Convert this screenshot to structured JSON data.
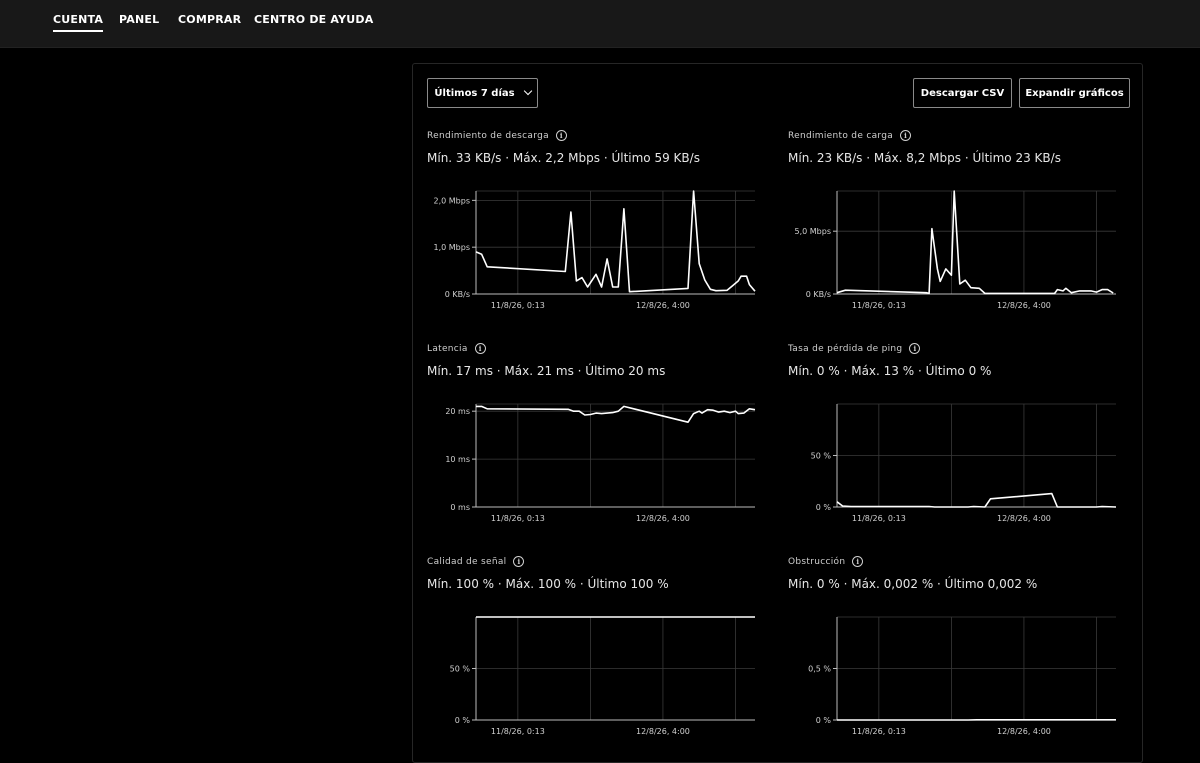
{
  "nav": {
    "items": [
      {
        "label": "CUENTA",
        "active": true
      },
      {
        "label": "PANEL",
        "active": false
      },
      {
        "label": "COMPRAR",
        "active": false
      },
      {
        "label": "CENTRO DE AYUDA",
        "active": false
      }
    ]
  },
  "toolbar": {
    "range_label": "Últimos 7 días",
    "download_label": "Descargar CSV",
    "expand_label": "Expandir gráficos"
  },
  "colors": {
    "line": "#ffffff",
    "grid": "#3a3a3a",
    "axis": "#bdbdbd"
  },
  "chart_data": [
    {
      "type": "line",
      "title": "Rendimiento de descarga",
      "stats": "Mín. 33 KB/s · Máx. 2,2 Mbps · Último 59 KB/s",
      "ylim": [
        0,
        2.2
      ],
      "yticks": [
        {
          "v": 0,
          "label": "0 KB/s"
        },
        {
          "v": 1.0,
          "label": "1,0 Mbps"
        },
        {
          "v": 2.0,
          "label": "2,0 Mbps"
        }
      ],
      "xticks": [
        {
          "t": 0.15,
          "label": "11/8/26, 0:13"
        },
        {
          "t": 0.67,
          "label": "12/8/26, 4:00"
        }
      ],
      "grid_x": [
        0.15,
        0.41,
        0.67,
        0.93
      ],
      "points": [
        [
          0,
          0.9
        ],
        [
          0.02,
          0.85
        ],
        [
          0.04,
          0.58
        ],
        [
          0.32,
          0.48
        ],
        [
          0.34,
          1.75
        ],
        [
          0.36,
          0.28
        ],
        [
          0.38,
          0.35
        ],
        [
          0.4,
          0.15
        ],
        [
          0.43,
          0.42
        ],
        [
          0.45,
          0.15
        ],
        [
          0.47,
          0.75
        ],
        [
          0.49,
          0.15
        ],
        [
          0.51,
          0.15
        ],
        [
          0.53,
          1.82
        ],
        [
          0.55,
          0.05
        ],
        [
          0.76,
          0.12
        ],
        [
          0.78,
          2.2
        ],
        [
          0.8,
          0.65
        ],
        [
          0.82,
          0.3
        ],
        [
          0.84,
          0.1
        ],
        [
          0.86,
          0.07
        ],
        [
          0.9,
          0.08
        ],
        [
          0.92,
          0.18
        ],
        [
          0.94,
          0.28
        ],
        [
          0.95,
          0.38
        ],
        [
          0.97,
          0.38
        ],
        [
          0.98,
          0.2
        ],
        [
          1.0,
          0.06
        ]
      ]
    },
    {
      "type": "line",
      "title": "Rendimiento de carga",
      "stats": "Mín. 23 KB/s · Máx. 8,2 Mbps · Último 23 KB/s",
      "ylim": [
        0,
        8.2
      ],
      "yticks": [
        {
          "v": 0,
          "label": "0 KB/s"
        },
        {
          "v": 5.0,
          "label": "5,0 Mbps"
        }
      ],
      "xticks": [
        {
          "t": 0.15,
          "label": "11/8/26, 0:13"
        },
        {
          "t": 0.67,
          "label": "12/8/26, 4:00"
        }
      ],
      "grid_x": [
        0.15,
        0.41,
        0.67,
        0.93
      ],
      "points": [
        [
          0,
          0.1
        ],
        [
          0.03,
          0.3
        ],
        [
          0.32,
          0.1
        ],
        [
          0.33,
          0.05
        ],
        [
          0.34,
          5.2
        ],
        [
          0.36,
          2.0
        ],
        [
          0.37,
          1.0
        ],
        [
          0.39,
          2.0
        ],
        [
          0.41,
          1.5
        ],
        [
          0.42,
          8.2
        ],
        [
          0.44,
          0.8
        ],
        [
          0.46,
          1.1
        ],
        [
          0.48,
          0.5
        ],
        [
          0.51,
          0.45
        ],
        [
          0.53,
          0.05
        ],
        [
          0.78,
          0.05
        ],
        [
          0.79,
          0.35
        ],
        [
          0.81,
          0.25
        ],
        [
          0.82,
          0.45
        ],
        [
          0.84,
          0.1
        ],
        [
          0.87,
          0.25
        ],
        [
          0.91,
          0.25
        ],
        [
          0.93,
          0.15
        ],
        [
          0.95,
          0.35
        ],
        [
          0.97,
          0.35
        ],
        [
          0.99,
          0.08
        ]
      ]
    },
    {
      "type": "line",
      "title": "Latencia",
      "stats": "Mín. 17 ms · Máx. 21 ms · Último 20 ms",
      "ylim": [
        0,
        21.5
      ],
      "yticks": [
        {
          "v": 0,
          "label": "0 ms"
        },
        {
          "v": 10,
          "label": "10 ms"
        },
        {
          "v": 20,
          "label": "20 ms"
        }
      ],
      "xticks": [
        {
          "t": 0.15,
          "label": "11/8/26, 0:13"
        },
        {
          "t": 0.67,
          "label": "12/8/26, 4:00"
        }
      ],
      "grid_x": [
        0.15,
        0.41,
        0.67,
        0.93
      ],
      "points": [
        [
          0,
          21
        ],
        [
          0.02,
          21
        ],
        [
          0.04,
          20.5
        ],
        [
          0.33,
          20.4
        ],
        [
          0.35,
          20.0
        ],
        [
          0.37,
          20.0
        ],
        [
          0.39,
          19.2
        ],
        [
          0.41,
          19.3
        ],
        [
          0.43,
          19.6
        ],
        [
          0.45,
          19.5
        ],
        [
          0.47,
          19.6
        ],
        [
          0.49,
          19.7
        ],
        [
          0.51,
          20.0
        ],
        [
          0.53,
          21.0
        ],
        [
          0.76,
          17.7
        ],
        [
          0.78,
          19.5
        ],
        [
          0.8,
          20.0
        ],
        [
          0.81,
          19.6
        ],
        [
          0.83,
          20.3
        ],
        [
          0.85,
          20.2
        ],
        [
          0.87,
          19.8
        ],
        [
          0.89,
          20.0
        ],
        [
          0.91,
          19.7
        ],
        [
          0.93,
          20.0
        ],
        [
          0.94,
          19.5
        ],
        [
          0.96,
          19.6
        ],
        [
          0.98,
          20.5
        ],
        [
          1.0,
          20.3
        ]
      ]
    },
    {
      "type": "line",
      "title": "Tasa de pérdida de ping",
      "stats": "Mín. 0 % · Máx. 13 % · Último 0 %",
      "ylim": [
        0,
        100
      ],
      "yticks": [
        {
          "v": 0,
          "label": "0 %"
        },
        {
          "v": 50,
          "label": "50 %"
        }
      ],
      "xticks": [
        {
          "t": 0.15,
          "label": "11/8/26, 0:13"
        },
        {
          "t": 0.67,
          "label": "12/8/26, 4:00"
        }
      ],
      "grid_x": [
        0.15,
        0.41,
        0.67,
        0.93
      ],
      "points": [
        [
          0,
          5
        ],
        [
          0.02,
          1
        ],
        [
          0.05,
          0.5
        ],
        [
          0.33,
          0.5
        ],
        [
          0.35,
          0
        ],
        [
          0.47,
          0
        ],
        [
          0.49,
          0.5
        ],
        [
          0.53,
          0
        ],
        [
          0.55,
          8
        ],
        [
          0.77,
          13
        ],
        [
          0.79,
          0
        ],
        [
          0.93,
          0
        ],
        [
          0.95,
          0.5
        ],
        [
          1.0,
          0
        ]
      ]
    },
    {
      "type": "line",
      "title": "Calidad de señal",
      "stats": "Mín. 100 % · Máx. 100 % · Último 100 %",
      "ylim": [
        0,
        100
      ],
      "yticks": [
        {
          "v": 0,
          "label": "0 %"
        },
        {
          "v": 50,
          "label": "50 %"
        }
      ],
      "xticks": [
        {
          "t": 0.15,
          "label": "11/8/26, 0:13"
        },
        {
          "t": 0.67,
          "label": "12/8/26, 4:00"
        }
      ],
      "grid_x": [
        0.15,
        0.41,
        0.67,
        0.93
      ],
      "points": [
        [
          0,
          100
        ],
        [
          0.5,
          100
        ],
        [
          1.0,
          100
        ]
      ]
    },
    {
      "type": "line",
      "title": "Obstrucción",
      "stats": "Mín. 0 % · Máx. 0,002 % · Último 0,002 %",
      "ylim": [
        0,
        1.0
      ],
      "yticks": [
        {
          "v": 0,
          "label": "0 %"
        },
        {
          "v": 0.5,
          "label": "0,5 %"
        }
      ],
      "xticks": [
        {
          "t": 0.15,
          "label": "11/8/26, 0:13"
        },
        {
          "t": 0.67,
          "label": "12/8/26, 4:00"
        }
      ],
      "grid_x": [
        0.15,
        0.41,
        0.67,
        0.93
      ],
      "points": [
        [
          0,
          0
        ],
        [
          0.47,
          0
        ],
        [
          0.5,
          0.002
        ],
        [
          0.55,
          0.002
        ],
        [
          1.0,
          0.002
        ]
      ]
    }
  ]
}
